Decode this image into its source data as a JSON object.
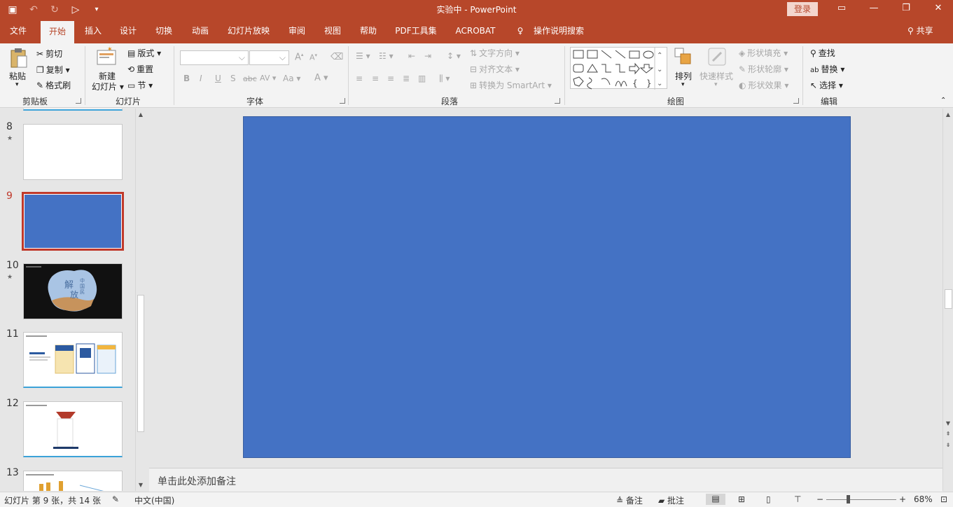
{
  "window": {
    "title": "实验中  -  PowerPoint",
    "login_label": "登录",
    "qat_icons": [
      "save-icon",
      "undo-icon",
      "redo-icon",
      "present-from-start-icon",
      "customize-qat-icon"
    ]
  },
  "tabs": [
    {
      "label": "文件",
      "active": false
    },
    {
      "label": "开始",
      "active": true
    },
    {
      "label": "插入",
      "active": false
    },
    {
      "label": "设计",
      "active": false
    },
    {
      "label": "切换",
      "active": false
    },
    {
      "label": "动画",
      "active": false
    },
    {
      "label": "幻灯片放映",
      "active": false
    },
    {
      "label": "审阅",
      "active": false
    },
    {
      "label": "视图",
      "active": false
    },
    {
      "label": "帮助",
      "active": false
    },
    {
      "label": "PDF工具集",
      "active": false
    },
    {
      "label": "ACROBAT",
      "active": false
    }
  ],
  "tell_me": "操作说明搜索",
  "share_label": "共享",
  "ribbon": {
    "clipboard": {
      "paste": "粘贴",
      "cut": "剪切",
      "copy": "复制",
      "format_painter": "格式刷",
      "label": "剪贴板"
    },
    "slides": {
      "new_slide": "新建",
      "new_slide2": "幻灯片",
      "layout": "版式",
      "reset": "重置",
      "section": "节",
      "label": "幻灯片"
    },
    "font": {
      "label": "字体",
      "bold": "B",
      "italic": "I",
      "underline": "U",
      "strike": "S",
      "abc": "abc",
      "av": "AV",
      "aa": "Aa",
      "grow": "A",
      "shrink": "A",
      "color_a": "A"
    },
    "paragraph": {
      "label": "段落",
      "text_direction": "文字方向",
      "align_text": "对齐文本",
      "smartart": "转换为 SmartArt"
    },
    "drawing": {
      "label": "绘图",
      "arrange": "排列",
      "quick_styles": "快速样式",
      "shape_fill": "形状填充",
      "shape_outline": "形状轮廓",
      "shape_effects": "形状效果"
    },
    "editing": {
      "label": "编辑",
      "find": "查找",
      "replace": "替换",
      "select": "选择"
    }
  },
  "thumbnails": [
    {
      "num": "8",
      "star": true,
      "kind": "blank"
    },
    {
      "num": "9",
      "star": false,
      "kind": "blue",
      "active": true
    },
    {
      "num": "10",
      "star": true,
      "kind": "dark"
    },
    {
      "num": "11",
      "star": false,
      "kind": "cards"
    },
    {
      "num": "12",
      "star": false,
      "kind": "single"
    },
    {
      "num": "13",
      "star": false,
      "kind": "partial"
    }
  ],
  "notes_placeholder": "单击此处添加备注",
  "status": {
    "slide_info": "幻灯片 第 9 张，共 14 张",
    "language": "中文(中国)",
    "notes": "备注",
    "comments": "批注",
    "zoom": "68%"
  },
  "colors": {
    "accent": "#b7472a",
    "slide_fill": "#4472c4"
  }
}
